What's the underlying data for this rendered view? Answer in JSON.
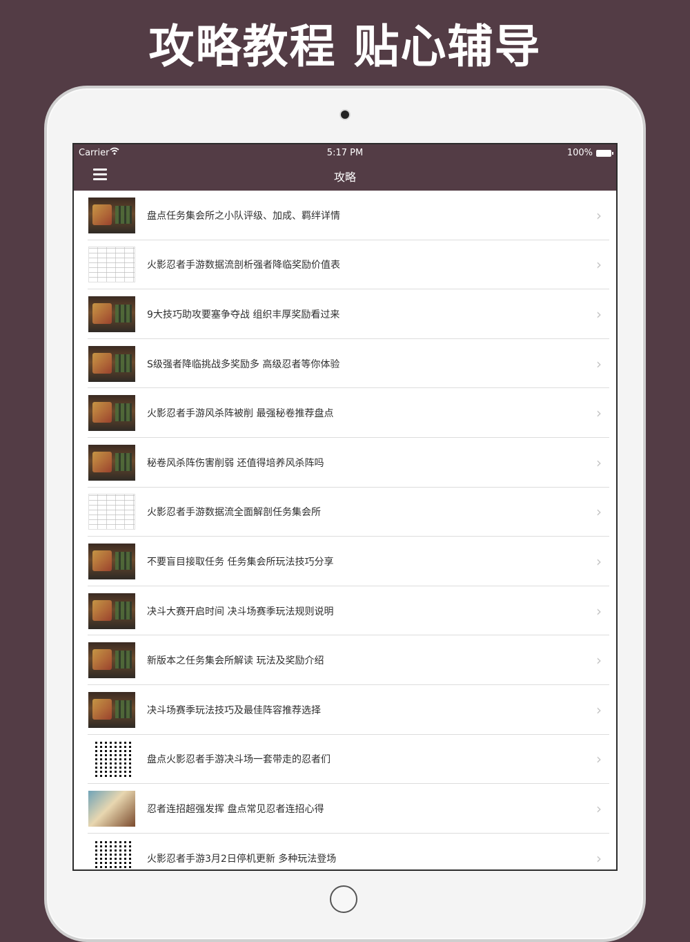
{
  "headline": "攻略教程 贴心辅导",
  "status_bar": {
    "carrier": "Carrier",
    "time": "5:17 PM",
    "battery": "100%"
  },
  "nav": {
    "title": "攻略",
    "menu_icon": "hamburger-menu-icon"
  },
  "chevron": "›",
  "articles": [
    {
      "title": "盘点任务集会所之小队评级、加成、羁绊详情",
      "thumb": "game"
    },
    {
      "title": "火影忍者手游数据流剖析强者降临奖励价值表",
      "thumb": "table"
    },
    {
      "title": "9大技巧助攻要塞争夺战 组织丰厚奖励看过来",
      "thumb": "game"
    },
    {
      "title": "S级强者降临挑战多奖励多 高级忍者等你体验",
      "thumb": "game"
    },
    {
      "title": "火影忍者手游风杀阵被削 最强秘卷推荐盘点",
      "thumb": "game"
    },
    {
      "title": "秘卷风杀阵伤害削弱 还值得培养风杀阵吗",
      "thumb": "game"
    },
    {
      "title": "火影忍者手游数据流全面解剖任务集会所",
      "thumb": "table"
    },
    {
      "title": "不要盲目接取任务 任务集会所玩法技巧分享",
      "thumb": "game"
    },
    {
      "title": "决斗大赛开启时间 决斗场赛季玩法规则说明",
      "thumb": "game"
    },
    {
      "title": "新版本之任务集会所解读 玩法及奖励介绍",
      "thumb": "game"
    },
    {
      "title": "决斗场赛季玩法技巧及最佳阵容推荐选择",
      "thumb": "game"
    },
    {
      "title": "盘点火影忍者手游决斗场一套带走的忍者们",
      "thumb": "qr"
    },
    {
      "title": "忍者连招超强发挥 盘点常见忍者连招心得",
      "thumb": "art"
    },
    {
      "title": "火影忍者手游3月2日停机更新 多种玩法登场",
      "thumb": "qr"
    }
  ]
}
